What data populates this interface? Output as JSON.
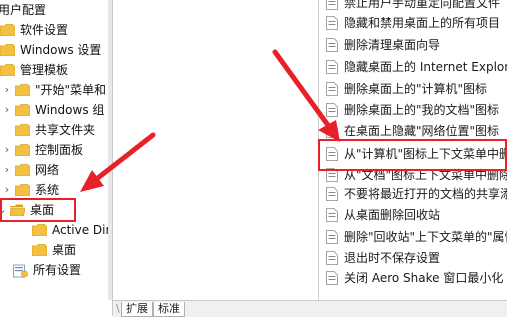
{
  "tree": {
    "items": [
      {
        "label": "用户配置",
        "expander": "",
        "icon": "none"
      },
      {
        "label": "软件设置",
        "expander": "",
        "icon": "folder"
      },
      {
        "label": "Windows 设置",
        "expander": "",
        "icon": "folder"
      },
      {
        "label": "管理模板",
        "expander": "",
        "icon": "folder"
      },
      {
        "label": "\"开始\"菜单和",
        "expander": "›",
        "icon": "folder"
      },
      {
        "label": "Windows 组",
        "expander": "›",
        "icon": "folder"
      },
      {
        "label": "共享文件夹",
        "expander": "",
        "icon": "folder"
      },
      {
        "label": "控制面板",
        "expander": "›",
        "icon": "folder"
      },
      {
        "label": "网络",
        "expander": "›",
        "icon": "folder"
      },
      {
        "label": "系统",
        "expander": "›",
        "icon": "folder"
      },
      {
        "label": "桌面",
        "expander": "⌄",
        "icon": "folder-open"
      },
      {
        "label": "Active Dir",
        "expander": "",
        "icon": "folder"
      },
      {
        "label": "桌面",
        "expander": "",
        "icon": "folder"
      },
      {
        "label": "所有设置",
        "expander": "",
        "icon": "settings"
      }
    ]
  },
  "policies": {
    "items": [
      "禁止用户手动重定向配置文件",
      "隐藏和禁用桌面上的所有项目",
      "删除清理桌面向导",
      "隐藏桌面上的 Internet Explorer",
      "删除桌面上的\"计算机\"图标",
      "删除桌面上的\"我的文档\"图标",
      "在桌面上隐藏\"网络位置\"图标",
      "从\"计算机\"图标上下文菜单中删除",
      "从\"文档\"图标上下文菜单中删除",
      "不要将最近打开的文档的共享添加",
      "从桌面删除回收站",
      "删除\"回收站\"上下文菜单的\"属性\"",
      "退出时不保存设置",
      "关闭 Aero Shake 窗口最小化"
    ]
  },
  "tabs": {
    "extended": "扩展",
    "standard": "标准"
  },
  "colors": {
    "highlight": "#e8202a",
    "folder": "#f2c043",
    "folder_dark": "#d9a21c"
  }
}
